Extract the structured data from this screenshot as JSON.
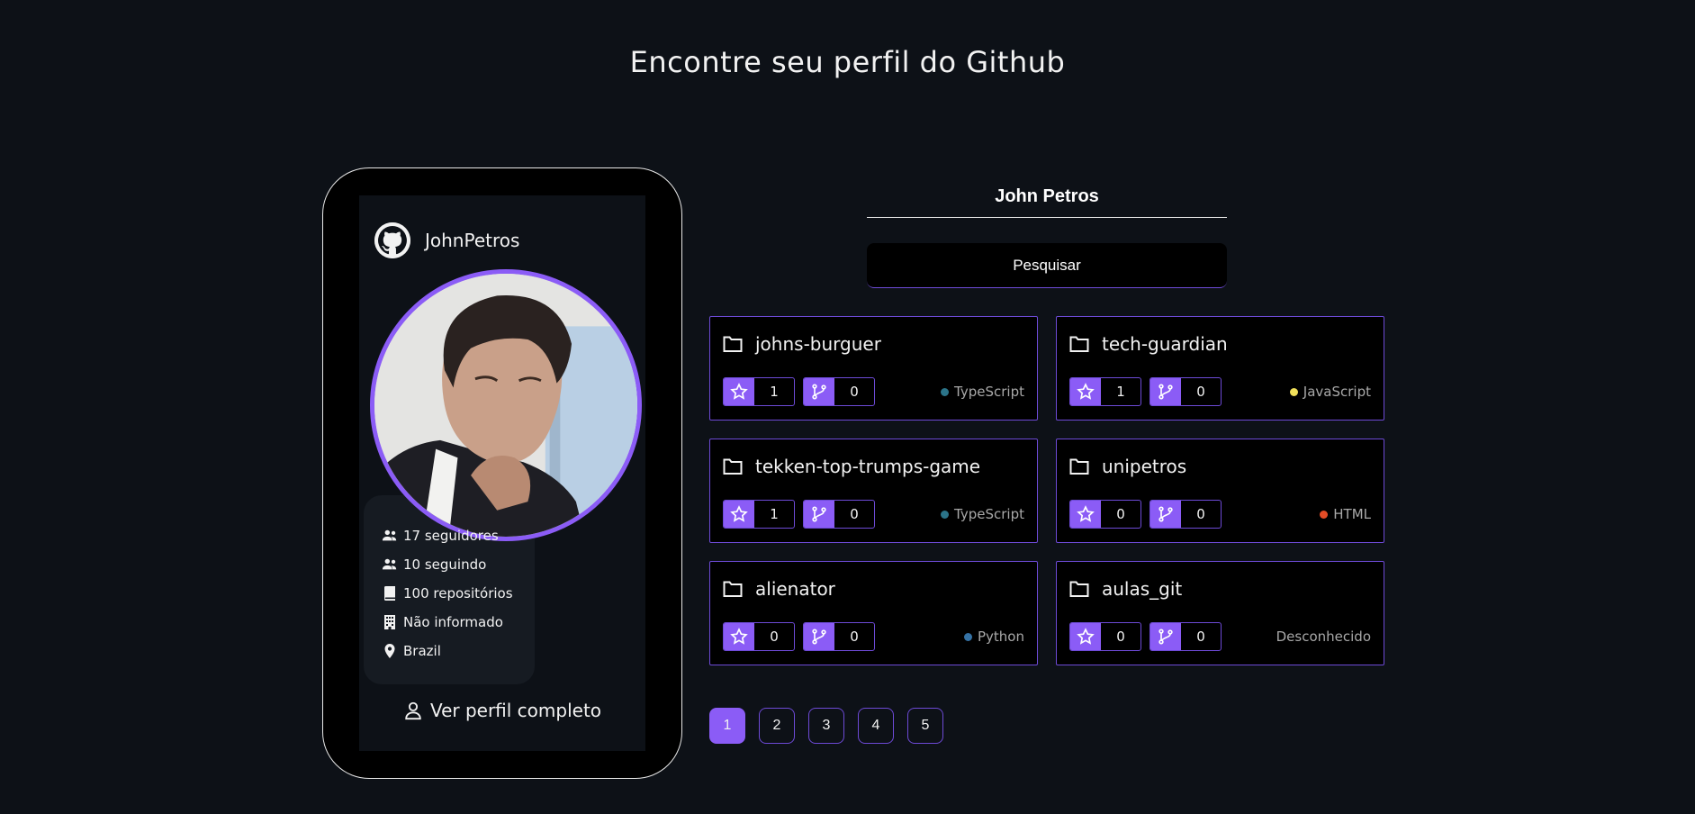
{
  "page": {
    "title": "Encontre seu perfil do Github"
  },
  "profile": {
    "username": "JohnPetros",
    "followers": "17 seguidores",
    "following": "10 seguindo",
    "repositories": "100 repositórios",
    "company": "Não informado",
    "location": "Brazil",
    "full_profile_label": "Ver perfil completo"
  },
  "search": {
    "value": "John Petros",
    "button_label": "Pesquisar"
  },
  "colors": {
    "accent": "#8b5cf6",
    "border": "#6d4ad6",
    "background": "#0d1117"
  },
  "repos": [
    {
      "name": "johns-burguer",
      "stars": "1",
      "forks": "0",
      "language": "TypeScript",
      "lang_color": "#3178c6"
    },
    {
      "name": "tech-guardian",
      "stars": "1",
      "forks": "0",
      "language": "JavaScript",
      "lang_color": "#f1e05a"
    },
    {
      "name": "tekken-top-trumps-game",
      "stars": "1",
      "forks": "0",
      "language": "TypeScript",
      "lang_color": "#3178c6"
    },
    {
      "name": "unipetros",
      "stars": "0",
      "forks": "0",
      "language": "HTML",
      "lang_color": "#e34c26"
    },
    {
      "name": "alienator",
      "stars": "0",
      "forks": "0",
      "language": "Python",
      "lang_color": "#3572a5"
    },
    {
      "name": "aulas_git",
      "stars": "0",
      "forks": "0",
      "language": "Desconhecido",
      "lang_color": ""
    }
  ],
  "pagination": {
    "pages": [
      "1",
      "2",
      "3",
      "4",
      "5"
    ],
    "current": "1"
  }
}
